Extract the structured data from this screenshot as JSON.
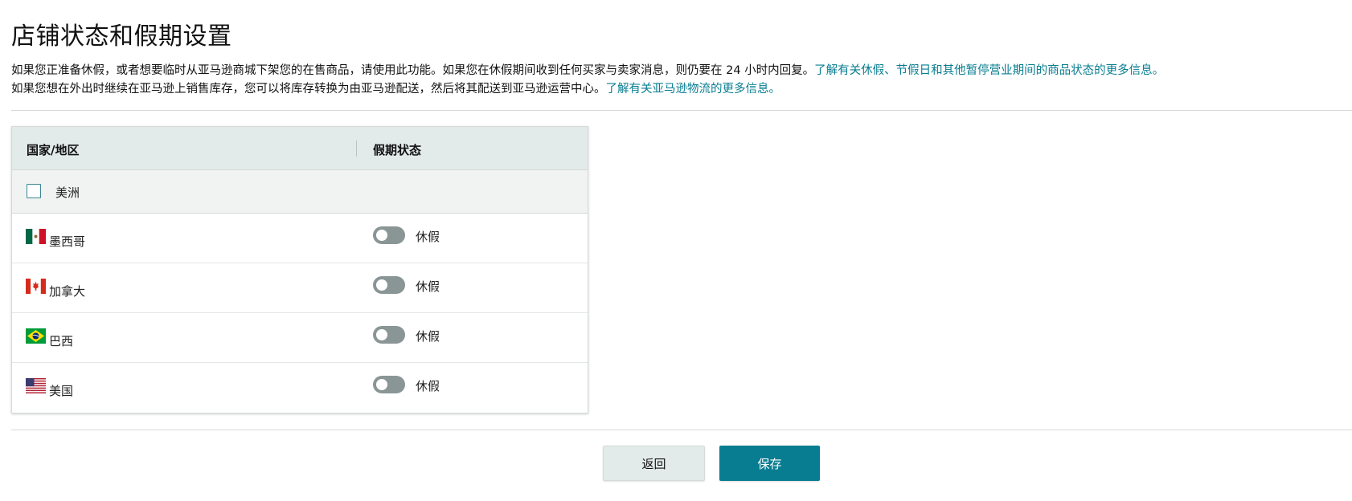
{
  "page": {
    "title": "店铺状态和假期设置",
    "description_line1_text": "如果您正准备休假，或者想要临时从亚马逊商城下架您的在售商品，请使用此功能。如果您在休假期间收到任何买家与卖家消息，则仍要在 24 小时内回复。",
    "description_line1_link": "了解有关休假、节假日和其他暂停营业期间的商品状态的更多信息。",
    "description_line2_text": "如果您想在外出时继续在亚马逊上销售库存，您可以将库存转换为由亚马逊配送，然后将其配送到亚马逊运营中心。",
    "description_line2_link": "了解有关亚马逊物流的更多信息。"
  },
  "table": {
    "col_country": "国家/地区",
    "col_status": "假期状态",
    "group_label": "美洲",
    "group_checked": false,
    "rows": [
      {
        "country": "墨西哥",
        "flag": "mexico-flag-icon",
        "toggle_label": "休假",
        "on": false
      },
      {
        "country": "加拿大",
        "flag": "canada-flag-icon",
        "toggle_label": "休假",
        "on": false
      },
      {
        "country": "巴西",
        "flag": "brazil-flag-icon",
        "toggle_label": "休假",
        "on": false
      },
      {
        "country": "美国",
        "flag": "usa-flag-icon",
        "toggle_label": "休假",
        "on": false
      }
    ]
  },
  "actions": {
    "back_label": "返回",
    "save_label": "保存"
  },
  "colors": {
    "accent": "#087d91",
    "link": "#087d91",
    "header_bg": "#e3eaea",
    "toggle_off": "#8a9595"
  }
}
